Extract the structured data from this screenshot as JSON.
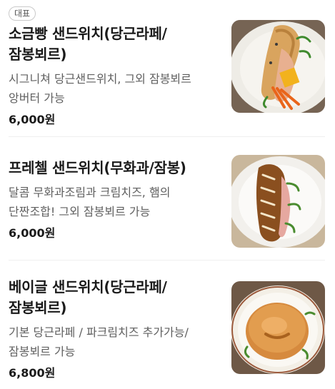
{
  "menu": {
    "items": [
      {
        "badge": "대표",
        "name": "소금빵 샌드위치(당근라페/ 잠봉뵈르)",
        "description": "시그니쳐 당근샌드위치, 그외 잠봉뵈르 앙버터 가능",
        "price": "6,000원",
        "image_icon": "salt-bread-sandwich-photo"
      },
      {
        "name": "프레첼 샌드위치(무화과/잠봉)",
        "description": "달콤 무화과조림과 크림치즈, 햄의 단짠조합! 그외 잠봉뵈르 가능",
        "price": "6,000원",
        "image_icon": "pretzel-sandwich-photo"
      },
      {
        "name": "베이글 샌드위치(당근라페/잠봉뵈르)",
        "description": "기본 당근라페 / 파크림치즈 추가가능/ 잠봉뵈르 가능",
        "price": "6,800원",
        "image_icon": "bagel-sandwich-photo"
      }
    ]
  },
  "colors": {
    "price_text": "#1a1a1a",
    "description_text": "#5f5f5f",
    "divider": "#efefef"
  }
}
